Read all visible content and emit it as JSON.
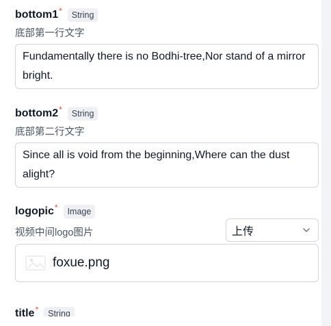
{
  "fields": [
    {
      "name": "bottom1",
      "required_mark": "*",
      "type": "String",
      "description": "底部第一行文字",
      "value": "Fundamentally there is no Bodhi-tree,Nor stand of a mirror bright."
    },
    {
      "name": "bottom2",
      "required_mark": "*",
      "type": "String",
      "description": "底部第二行文字",
      "value": "Since all is void from the beginning,Where can the dust alight?"
    },
    {
      "name": "logopic",
      "required_mark": "*",
      "type": "Image",
      "description": "视频中间logo图片",
      "upload_mode": "上传",
      "file_name": "foxue.png"
    },
    {
      "name": "title",
      "required_mark": "*",
      "type": "String"
    }
  ],
  "icons": {
    "select_chevron": "chevron-down-icon",
    "file_thumbnail": "image-icon"
  }
}
